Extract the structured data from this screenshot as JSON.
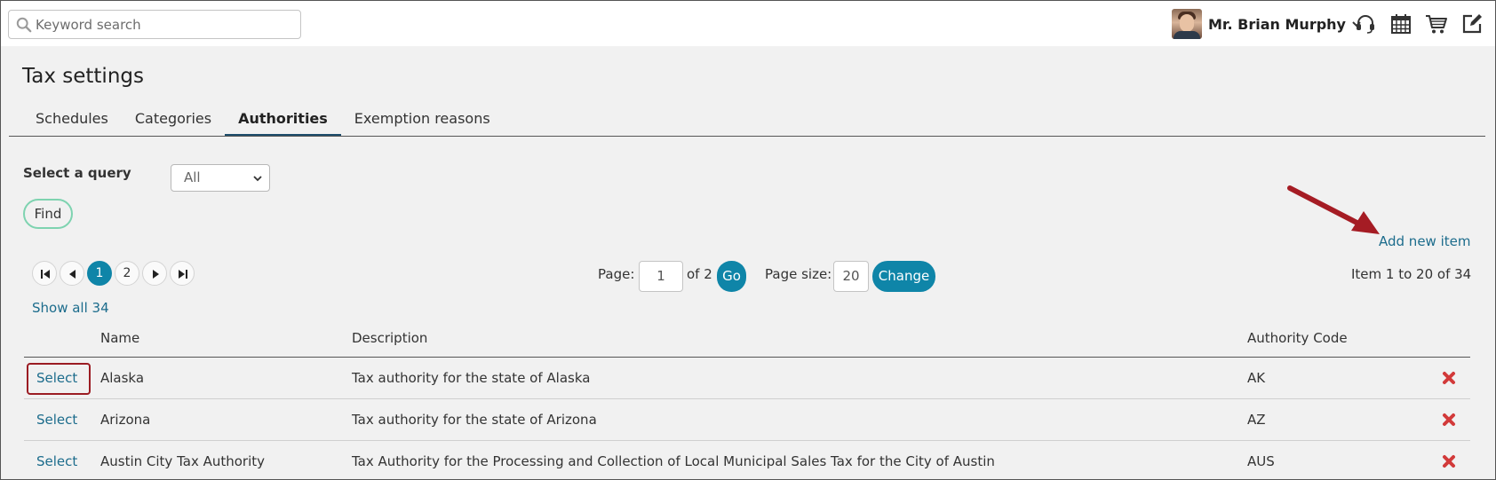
{
  "search": {
    "placeholder": "Keyword search"
  },
  "user": {
    "name": "Mr. Brian Murphy"
  },
  "page": {
    "title": "Tax settings"
  },
  "tabs": [
    {
      "label": "Schedules"
    },
    {
      "label": "Categories"
    },
    {
      "label": "Authorities"
    },
    {
      "label": "Exemption reasons"
    }
  ],
  "query": {
    "label": "Select a query",
    "selected": "All"
  },
  "find_label": "Find",
  "add_new_label": "Add new item",
  "pager": {
    "pages": [
      "1",
      "2"
    ],
    "page_label": "Page:",
    "page_value": "1",
    "of_label": "of 2",
    "go_label": "Go",
    "page_size_label": "Page size:",
    "page_size_value": "20",
    "change_label": "Change",
    "item_count": "Item 1 to 20 of 34",
    "show_all": "Show all 34"
  },
  "grid": {
    "headers": {
      "name": "Name",
      "description": "Description",
      "code": "Authority Code"
    },
    "select_label": "Select",
    "rows": [
      {
        "name": "Alaska",
        "description": "Tax authority for the state of Alaska",
        "code": "AK"
      },
      {
        "name": "Arizona",
        "description": "Tax authority for the state of Arizona",
        "code": "AZ"
      },
      {
        "name": "Austin City Tax Authority",
        "description": "Tax Authority for the Processing and Collection of Local Municipal Sales Tax for the City of Austin",
        "code": "AUS"
      }
    ]
  },
  "colors": {
    "accent": "#0f85a8",
    "link": "#1c6c8c",
    "highlight": "#9b1c23",
    "delete": "#d23a3a"
  }
}
